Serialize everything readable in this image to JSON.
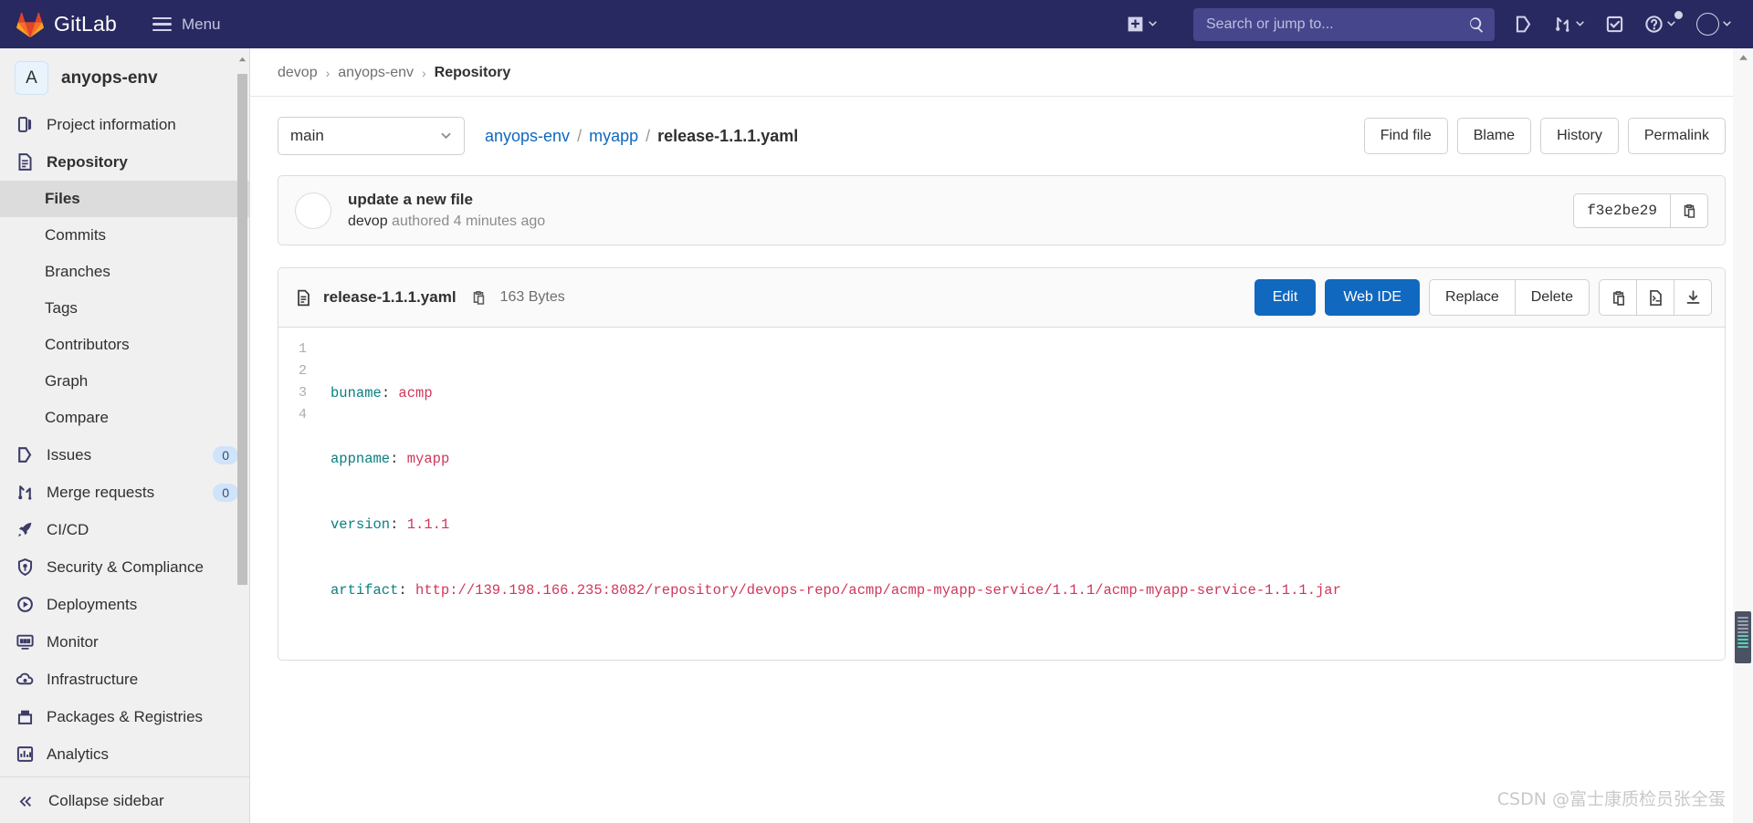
{
  "topbar": {
    "brand_name": "GitLab",
    "menu_label": "Menu",
    "search_placeholder": "Search or jump to...",
    "icons": {
      "create_new": "plus-square-icon",
      "create_new_caret": "chevron-down-icon",
      "search": "search-icon",
      "issues": "issues-icon",
      "merge_requests": "merge-request-icon",
      "merge_requests_caret": "chevron-down-icon",
      "todos": "todo-check-icon",
      "help": "help-circle-icon",
      "help_caret": "chevron-down-icon",
      "avatar": "user-avatar",
      "avatar_caret": "chevron-down-icon"
    }
  },
  "sidebar": {
    "project_initial": "A",
    "project_name": "anyops-env",
    "items": [
      {
        "label": "Project information",
        "icon": "project-info-icon",
        "bold": false
      },
      {
        "label": "Repository",
        "icon": "repository-doc-icon",
        "bold": true
      }
    ],
    "sub_items": [
      {
        "label": "Files",
        "active": true
      },
      {
        "label": "Commits",
        "active": false
      },
      {
        "label": "Branches",
        "active": false
      },
      {
        "label": "Tags",
        "active": false
      },
      {
        "label": "Contributors",
        "active": false
      },
      {
        "label": "Graph",
        "active": false
      },
      {
        "label": "Compare",
        "active": false
      }
    ],
    "items_lower": [
      {
        "label": "Issues",
        "icon": "issues-icon",
        "badge": "0"
      },
      {
        "label": "Merge requests",
        "icon": "merge-request-icon",
        "badge": "0"
      },
      {
        "label": "CI/CD",
        "icon": "rocket-icon",
        "badge": ""
      },
      {
        "label": "Security & Compliance",
        "icon": "shield-icon",
        "badge": ""
      },
      {
        "label": "Deployments",
        "icon": "deployments-icon",
        "badge": ""
      },
      {
        "label": "Monitor",
        "icon": "monitor-icon",
        "badge": ""
      },
      {
        "label": "Infrastructure",
        "icon": "cloud-gear-icon",
        "badge": ""
      },
      {
        "label": "Packages & Registries",
        "icon": "package-icon",
        "badge": ""
      },
      {
        "label": "Analytics",
        "icon": "chart-bar-icon",
        "badge": ""
      }
    ],
    "collapse_label": "Collapse sidebar",
    "collapse_icon": "double-chevron-left-icon"
  },
  "breadcrumb": {
    "items": [
      {
        "label": "devop",
        "current": false
      },
      {
        "label": "anyops-env",
        "current": false
      },
      {
        "label": "Repository",
        "current": true
      }
    ],
    "separator": "›"
  },
  "file_head": {
    "branch": "main",
    "branch_caret": "chevron-down-icon",
    "path": [
      {
        "label": "anyops-env",
        "current": false
      },
      {
        "label": "myapp",
        "current": false
      },
      {
        "label": "release-1.1.1.yaml",
        "current": true
      }
    ],
    "path_separator": "/",
    "buttons": [
      "Find file",
      "Blame",
      "History",
      "Permalink"
    ]
  },
  "commit": {
    "title": "update a new file",
    "author": "devop",
    "meta_suffix": "authored 4 minutes ago",
    "sha": "f3e2be29",
    "copy_icon": "copy-clipboard-icon",
    "avatar": "user-avatar"
  },
  "file_card": {
    "doc_icon": "file-doc-icon",
    "file_name": "release-1.1.1.yaml",
    "copy_path_icon": "copy-clipboard-icon",
    "file_size": "163 Bytes",
    "primary_buttons": [
      "Edit",
      "Web IDE"
    ],
    "group_buttons": [
      "Replace",
      "Delete"
    ],
    "icon_buttons": [
      "copy-clipboard-icon",
      "open-raw-file-icon",
      "download-icon"
    ]
  },
  "code": {
    "lines": [
      {
        "num": "1",
        "key": "buname",
        "value": "acmp"
      },
      {
        "num": "2",
        "key": "appname",
        "value": "myapp"
      },
      {
        "num": "3",
        "key": "version",
        "value": "1.1.1"
      },
      {
        "num": "4",
        "key": "artifact",
        "value": "http://139.198.166.235:8082/repository/devops-repo/acmp/acmp-myapp-service/1.1.1/acmp-myapp-service-1.1.1.jar"
      }
    ]
  },
  "watermark": "CSDN @富士康质检员张全蛋"
}
